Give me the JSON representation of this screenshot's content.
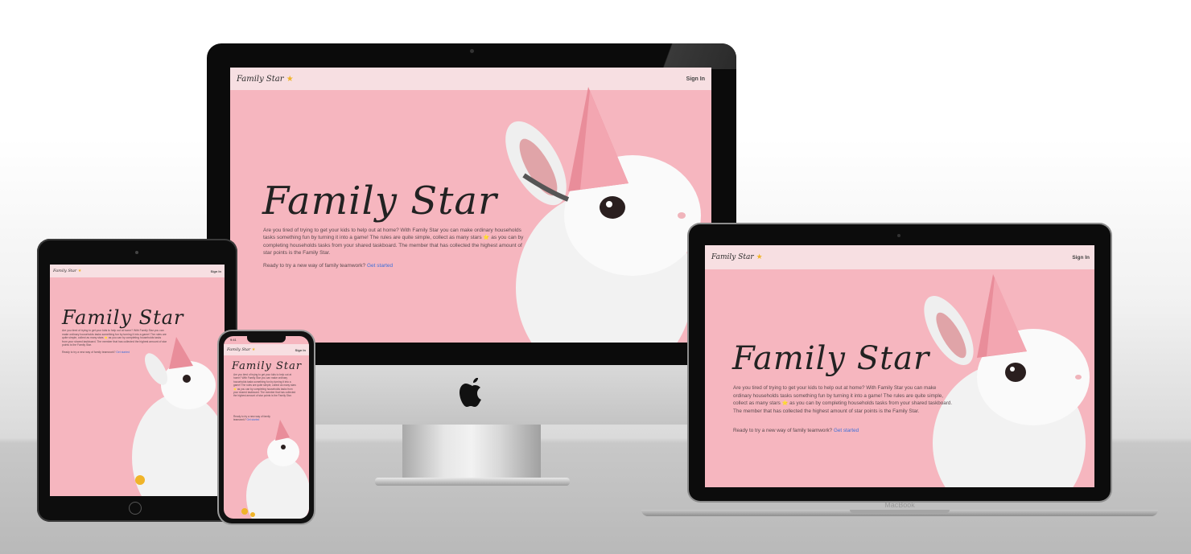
{
  "site": {
    "logo_text": "Family Star",
    "logo_star": "★",
    "sign_in": "Sign In",
    "hero_title": "Family Star",
    "description": "Are you tired of trying to get your kids to help out at home? With Family Star you can make ordinary households tasks something fun by turning it into a game! The rules are quite simple, collect as many stars ⭐ as you can by completing households tasks from your shared taskboard. The member that has collected the highest amount of star points is the Family Star.",
    "cta_text": "Ready to try a new way of family teamwork?",
    "cta_link": "Get started"
  },
  "devices": {
    "laptop_brand": "MacBook",
    "phone_time": "9:41"
  },
  "colors": {
    "hero_bg": "#f6b6bf",
    "nav_bg": "#f7dfe2",
    "link": "#3d6fd9",
    "star": "#f0b429"
  },
  "icons": {
    "apple_logo": "apple-logo-icon",
    "star": "star-icon"
  }
}
